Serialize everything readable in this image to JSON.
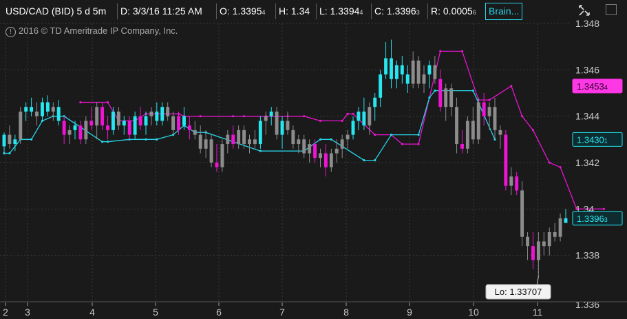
{
  "header": {
    "symbol": "USD/CAD (BID) 5 d 5m",
    "date": "D: 3/3/16 11:25 AM",
    "open_main": "O: 1.3395",
    "open_small": "4",
    "high": "H: 1.34",
    "low_main": "L: 1.3394",
    "low_small": "4",
    "close_main": "C: 1.3396",
    "close_small": "3",
    "range_main": "R: 0.0005",
    "range_small": "6",
    "study": "Brain..."
  },
  "copyright": "2016 © TD Ameritrade IP Company, Inc.",
  "icons": {
    "copyright": "circle-exclamation-icon",
    "corner": "expand-collapse-icon",
    "close": "close-box-icon"
  },
  "colors": {
    "background": "#1a1a1a",
    "up_candle": "#27e6f0",
    "down_candle": "#ee14d4",
    "neutral_candle": "#8c8c8c",
    "grid": "#3a3a3a",
    "upper_band": "#e814d0",
    "lower_band": "#27d4e8"
  },
  "chart_data": {
    "type": "candlestick",
    "title": "USD/CAD (BID) 5 d 5m",
    "ylim": [
      1.336,
      1.348
    ],
    "y_ticks": [
      "1.338",
      "1.34",
      "1.342",
      "1.344",
      "1.346",
      "1.348"
    ],
    "x_ticks": [
      "2",
      "3",
      "4",
      "5",
      "6",
      "7",
      "8",
      "9",
      "10",
      "11"
    ],
    "grid": true,
    "price_tags": [
      {
        "label": "1.34534",
        "main": "1.3453",
        "small": "4",
        "value": 1.3453,
        "style": "magenta"
      },
      {
        "label": "1.34301",
        "main": "1.3430",
        "small": "1",
        "value": 1.343,
        "style": "cyan"
      },
      {
        "label": "1.33963",
        "main": "1.3396",
        "small": "3",
        "value": 1.3396,
        "style": "cyan-last"
      }
    ],
    "low_callout": "Lo: 1.33707",
    "candles": [
      {
        "o": 1.3427,
        "h": 1.3433,
        "l": 1.3424,
        "c": 1.3432,
        "t": "up"
      },
      {
        "o": 1.3432,
        "h": 1.3436,
        "l": 1.3426,
        "c": 1.3428,
        "t": "neutral"
      },
      {
        "o": 1.3428,
        "h": 1.3432,
        "l": 1.3425,
        "c": 1.343,
        "t": "up"
      },
      {
        "o": 1.343,
        "h": 1.3444,
        "l": 1.3428,
        "c": 1.3442,
        "t": "neutral"
      },
      {
        "o": 1.3442,
        "h": 1.3446,
        "l": 1.3438,
        "c": 1.3444,
        "t": "up"
      },
      {
        "o": 1.3444,
        "h": 1.3448,
        "l": 1.344,
        "c": 1.3442,
        "t": "up"
      },
      {
        "o": 1.3442,
        "h": 1.3446,
        "l": 1.3436,
        "c": 1.344,
        "t": "neutral"
      },
      {
        "o": 1.344,
        "h": 1.3448,
        "l": 1.3438,
        "c": 1.3446,
        "t": "up"
      },
      {
        "o": 1.3446,
        "h": 1.3449,
        "l": 1.344,
        "c": 1.3442,
        "t": "up"
      },
      {
        "o": 1.3442,
        "h": 1.3446,
        "l": 1.3438,
        "c": 1.3444,
        "t": "neutral"
      },
      {
        "o": 1.3444,
        "h": 1.3447,
        "l": 1.3436,
        "c": 1.3438,
        "t": "up"
      },
      {
        "o": 1.3438,
        "h": 1.344,
        "l": 1.3428,
        "c": 1.3432,
        "t": "down"
      },
      {
        "o": 1.3432,
        "h": 1.3436,
        "l": 1.3428,
        "c": 1.3434,
        "t": "neutral"
      },
      {
        "o": 1.3434,
        "h": 1.3438,
        "l": 1.343,
        "c": 1.3436,
        "t": "up"
      },
      {
        "o": 1.3436,
        "h": 1.3438,
        "l": 1.3428,
        "c": 1.343,
        "t": "down"
      },
      {
        "o": 1.343,
        "h": 1.344,
        "l": 1.3428,
        "c": 1.3438,
        "t": "neutral"
      },
      {
        "o": 1.3438,
        "h": 1.3444,
        "l": 1.3434,
        "c": 1.3436,
        "t": "down"
      },
      {
        "o": 1.3436,
        "h": 1.3446,
        "l": 1.343,
        "c": 1.3444,
        "t": "neutral"
      },
      {
        "o": 1.3444,
        "h": 1.3446,
        "l": 1.3434,
        "c": 1.3436,
        "t": "down"
      },
      {
        "o": 1.3436,
        "h": 1.344,
        "l": 1.343,
        "c": 1.3434,
        "t": "down"
      },
      {
        "o": 1.3434,
        "h": 1.3444,
        "l": 1.3432,
        "c": 1.3442,
        "t": "up"
      },
      {
        "o": 1.3442,
        "h": 1.3444,
        "l": 1.3434,
        "c": 1.3436,
        "t": "neutral"
      },
      {
        "o": 1.3436,
        "h": 1.344,
        "l": 1.3432,
        "c": 1.3438,
        "t": "up"
      },
      {
        "o": 1.3438,
        "h": 1.344,
        "l": 1.343,
        "c": 1.3432,
        "t": "down"
      },
      {
        "o": 1.3432,
        "h": 1.3442,
        "l": 1.343,
        "c": 1.344,
        "t": "up"
      },
      {
        "o": 1.344,
        "h": 1.3444,
        "l": 1.3434,
        "c": 1.3436,
        "t": "down"
      },
      {
        "o": 1.3436,
        "h": 1.3442,
        "l": 1.3432,
        "c": 1.344,
        "t": "up"
      },
      {
        "o": 1.344,
        "h": 1.3444,
        "l": 1.3436,
        "c": 1.3442,
        "t": "neutral"
      },
      {
        "o": 1.3442,
        "h": 1.3446,
        "l": 1.3436,
        "c": 1.3438,
        "t": "up"
      },
      {
        "o": 1.3438,
        "h": 1.3446,
        "l": 1.3436,
        "c": 1.3444,
        "t": "up"
      },
      {
        "o": 1.3444,
        "h": 1.3446,
        "l": 1.3438,
        "c": 1.344,
        "t": "neutral"
      },
      {
        "o": 1.344,
        "h": 1.3442,
        "l": 1.3432,
        "c": 1.3434,
        "t": "neutral"
      },
      {
        "o": 1.3434,
        "h": 1.3442,
        "l": 1.3432,
        "c": 1.344,
        "t": "down"
      },
      {
        "o": 1.344,
        "h": 1.3444,
        "l": 1.3434,
        "c": 1.3436,
        "t": "up"
      },
      {
        "o": 1.3436,
        "h": 1.344,
        "l": 1.343,
        "c": 1.3434,
        "t": "down"
      },
      {
        "o": 1.3434,
        "h": 1.3438,
        "l": 1.343,
        "c": 1.3432,
        "t": "neutral"
      },
      {
        "o": 1.3432,
        "h": 1.3436,
        "l": 1.3424,
        "c": 1.3426,
        "t": "neutral"
      },
      {
        "o": 1.3426,
        "h": 1.3434,
        "l": 1.3422,
        "c": 1.343,
        "t": "neutral"
      },
      {
        "o": 1.343,
        "h": 1.3432,
        "l": 1.3418,
        "c": 1.342,
        "t": "neutral"
      },
      {
        "o": 1.342,
        "h": 1.3428,
        "l": 1.3416,
        "c": 1.3418,
        "t": "down"
      },
      {
        "o": 1.3418,
        "h": 1.343,
        "l": 1.3416,
        "c": 1.3428,
        "t": "neutral"
      },
      {
        "o": 1.3428,
        "h": 1.3434,
        "l": 1.3424,
        "c": 1.3432,
        "t": "neutral"
      },
      {
        "o": 1.3432,
        "h": 1.3436,
        "l": 1.3426,
        "c": 1.3428,
        "t": "down"
      },
      {
        "o": 1.3428,
        "h": 1.3436,
        "l": 1.3426,
        "c": 1.3434,
        "t": "neutral"
      },
      {
        "o": 1.3434,
        "h": 1.3436,
        "l": 1.3426,
        "c": 1.3428,
        "t": "neutral"
      },
      {
        "o": 1.3428,
        "h": 1.3432,
        "l": 1.3424,
        "c": 1.343,
        "t": "neutral"
      },
      {
        "o": 1.343,
        "h": 1.3434,
        "l": 1.3426,
        "c": 1.3428,
        "t": "neutral"
      },
      {
        "o": 1.3428,
        "h": 1.344,
        "l": 1.3426,
        "c": 1.3438,
        "t": "up"
      },
      {
        "o": 1.3438,
        "h": 1.3442,
        "l": 1.3432,
        "c": 1.344,
        "t": "neutral"
      },
      {
        "o": 1.344,
        "h": 1.3444,
        "l": 1.3436,
        "c": 1.3442,
        "t": "up"
      },
      {
        "o": 1.3442,
        "h": 1.3444,
        "l": 1.343,
        "c": 1.3432,
        "t": "neutral"
      },
      {
        "o": 1.3432,
        "h": 1.344,
        "l": 1.3426,
        "c": 1.3438,
        "t": "up"
      },
      {
        "o": 1.3438,
        "h": 1.3442,
        "l": 1.3432,
        "c": 1.3434,
        "t": "neutral"
      },
      {
        "o": 1.3434,
        "h": 1.3436,
        "l": 1.3426,
        "c": 1.3428,
        "t": "neutral"
      },
      {
        "o": 1.3428,
        "h": 1.3432,
        "l": 1.3424,
        "c": 1.343,
        "t": "neutral"
      },
      {
        "o": 1.343,
        "h": 1.3432,
        "l": 1.3422,
        "c": 1.3424,
        "t": "neutral"
      },
      {
        "o": 1.3424,
        "h": 1.343,
        "l": 1.342,
        "c": 1.3428,
        "t": "neutral"
      },
      {
        "o": 1.3428,
        "h": 1.343,
        "l": 1.342,
        "c": 1.3422,
        "t": "down"
      },
      {
        "o": 1.3422,
        "h": 1.3426,
        "l": 1.3418,
        "c": 1.3424,
        "t": "neutral"
      },
      {
        "o": 1.3424,
        "h": 1.3428,
        "l": 1.3414,
        "c": 1.3418,
        "t": "down"
      },
      {
        "o": 1.3418,
        "h": 1.3426,
        "l": 1.3416,
        "c": 1.3424,
        "t": "neutral"
      },
      {
        "o": 1.3424,
        "h": 1.343,
        "l": 1.342,
        "c": 1.3426,
        "t": "neutral"
      },
      {
        "o": 1.3426,
        "h": 1.3432,
        "l": 1.3422,
        "c": 1.343,
        "t": "neutral"
      },
      {
        "o": 1.343,
        "h": 1.3434,
        "l": 1.3426,
        "c": 1.3432,
        "t": "neutral"
      },
      {
        "o": 1.3432,
        "h": 1.344,
        "l": 1.343,
        "c": 1.3438,
        "t": "up"
      },
      {
        "o": 1.3438,
        "h": 1.3444,
        "l": 1.3434,
        "c": 1.3442,
        "t": "up"
      },
      {
        "o": 1.3442,
        "h": 1.3448,
        "l": 1.3434,
        "c": 1.3436,
        "t": "up"
      },
      {
        "o": 1.3436,
        "h": 1.3446,
        "l": 1.3432,
        "c": 1.3444,
        "t": "neutral"
      },
      {
        "o": 1.3444,
        "h": 1.345,
        "l": 1.3438,
        "c": 1.3448,
        "t": "up"
      },
      {
        "o": 1.3448,
        "h": 1.346,
        "l": 1.3444,
        "c": 1.3458,
        "t": "up"
      },
      {
        "o": 1.3458,
        "h": 1.3472,
        "l": 1.3456,
        "c": 1.3465,
        "t": "up"
      },
      {
        "o": 1.3465,
        "h": 1.3473,
        "l": 1.3452,
        "c": 1.3456,
        "t": "up"
      },
      {
        "o": 1.3456,
        "h": 1.3464,
        "l": 1.3452,
        "c": 1.3462,
        "t": "up"
      },
      {
        "o": 1.3462,
        "h": 1.3466,
        "l": 1.3454,
        "c": 1.3458,
        "t": "up"
      },
      {
        "o": 1.3458,
        "h": 1.3462,
        "l": 1.345,
        "c": 1.3454,
        "t": "up"
      },
      {
        "o": 1.3454,
        "h": 1.3468,
        "l": 1.3452,
        "c": 1.3464,
        "t": "neutral"
      },
      {
        "o": 1.3464,
        "h": 1.3466,
        "l": 1.3452,
        "c": 1.3454,
        "t": "neutral"
      },
      {
        "o": 1.3454,
        "h": 1.3462,
        "l": 1.345,
        "c": 1.3458,
        "t": "neutral"
      },
      {
        "o": 1.3458,
        "h": 1.3464,
        "l": 1.3452,
        "c": 1.3462,
        "t": "up"
      },
      {
        "o": 1.3462,
        "h": 1.3466,
        "l": 1.3454,
        "c": 1.3456,
        "t": "neutral"
      },
      {
        "o": 1.3456,
        "h": 1.346,
        "l": 1.3442,
        "c": 1.3444,
        "t": "down"
      },
      {
        "o": 1.3444,
        "h": 1.3454,
        "l": 1.3438,
        "c": 1.3452,
        "t": "neutral"
      },
      {
        "o": 1.3452,
        "h": 1.3454,
        "l": 1.344,
        "c": 1.3444,
        "t": "neutral"
      },
      {
        "o": 1.3444,
        "h": 1.3448,
        "l": 1.3424,
        "c": 1.3428,
        "t": "neutral"
      },
      {
        "o": 1.3428,
        "h": 1.3434,
        "l": 1.3424,
        "c": 1.3426,
        "t": "down"
      },
      {
        "o": 1.3426,
        "h": 1.344,
        "l": 1.3424,
        "c": 1.3438,
        "t": "neutral"
      },
      {
        "o": 1.3438,
        "h": 1.3444,
        "l": 1.3428,
        "c": 1.343,
        "t": "neutral"
      },
      {
        "o": 1.343,
        "h": 1.3448,
        "l": 1.3428,
        "c": 1.3446,
        "t": "neutral"
      },
      {
        "o": 1.3446,
        "h": 1.345,
        "l": 1.3436,
        "c": 1.344,
        "t": "down"
      },
      {
        "o": 1.344,
        "h": 1.3446,
        "l": 1.3434,
        "c": 1.3444,
        "t": "neutral"
      },
      {
        "o": 1.3444,
        "h": 1.3448,
        "l": 1.343,
        "c": 1.3434,
        "t": "neutral"
      },
      {
        "o": 1.3434,
        "h": 1.3436,
        "l": 1.3426,
        "c": 1.3432,
        "t": "neutral"
      },
      {
        "o": 1.3432,
        "h": 1.3434,
        "l": 1.3408,
        "c": 1.341,
        "t": "down"
      },
      {
        "o": 1.341,
        "h": 1.3418,
        "l": 1.3406,
        "c": 1.3414,
        "t": "neutral"
      },
      {
        "o": 1.3414,
        "h": 1.3416,
        "l": 1.3406,
        "c": 1.3408,
        "t": "down"
      },
      {
        "o": 1.3408,
        "h": 1.3412,
        "l": 1.3384,
        "c": 1.3388,
        "t": "neutral"
      },
      {
        "o": 1.3388,
        "h": 1.339,
        "l": 1.3378,
        "c": 1.3384,
        "t": "neutral"
      },
      {
        "o": 1.3384,
        "h": 1.339,
        "l": 1.3374,
        "c": 1.3378,
        "t": "down"
      },
      {
        "o": 1.3378,
        "h": 1.339,
        "l": 1.3371,
        "c": 1.3386,
        "t": "neutral"
      },
      {
        "o": 1.3386,
        "h": 1.339,
        "l": 1.338,
        "c": 1.3384,
        "t": "neutral"
      },
      {
        "o": 1.3384,
        "h": 1.3392,
        "l": 1.338,
        "c": 1.339,
        "t": "neutral"
      },
      {
        "o": 1.339,
        "h": 1.3394,
        "l": 1.3386,
        "c": 1.3388,
        "t": "neutral"
      },
      {
        "o": 1.3388,
        "h": 1.3398,
        "l": 1.3386,
        "c": 1.3396,
        "t": "neutral"
      },
      {
        "o": 1.3394,
        "h": 1.34,
        "l": 1.3394,
        "c": 1.3396,
        "t": "up"
      }
    ],
    "upper_band": [
      {
        "i": 14,
        "v": 1.3446
      },
      {
        "i": 19,
        "v": 1.3446
      },
      {
        "i": 21,
        "v": 1.3438
      },
      {
        "i": 24,
        "v": 1.3438
      },
      {
        "i": 26,
        "v": 1.3441
      },
      {
        "i": 32,
        "v": 1.3441
      },
      {
        "i": 33,
        "v": 1.344
      },
      {
        "i": 36,
        "v": 1.344
      },
      {
        "i": 42,
        "v": 1.344
      },
      {
        "i": 44,
        "v": 1.344
      },
      {
        "i": 48,
        "v": 1.344
      },
      {
        "i": 52,
        "v": 1.344
      },
      {
        "i": 55,
        "v": 1.344
      },
      {
        "i": 58,
        "v": 1.3438
      },
      {
        "i": 62,
        "v": 1.3438
      },
      {
        "i": 63,
        "v": 1.3441
      },
      {
        "i": 64,
        "v": 1.3441
      },
      {
        "i": 68,
        "v": 1.3432
      },
      {
        "i": 71,
        "v": 1.3432
      },
      {
        "i": 73,
        "v": 1.3428
      },
      {
        "i": 76,
        "v": 1.3428
      },
      {
        "i": 80,
        "v": 1.3468
      },
      {
        "i": 84,
        "v": 1.3468
      },
      {
        "i": 87,
        "v": 1.3447
      },
      {
        "i": 89,
        "v": 1.3447
      },
      {
        "i": 93,
        "v": 1.3453
      },
      {
        "i": 95,
        "v": 1.344
      },
      {
        "i": 97,
        "v": 1.3434
      },
      {
        "i": 100,
        "v": 1.342
      },
      {
        "i": 102,
        "v": 1.3418
      },
      {
        "i": 105,
        "v": 1.34
      },
      {
        "i": 110,
        "v": 1.34
      }
    ],
    "lower_band": [
      {
        "i": 0,
        "v": 1.3424
      },
      {
        "i": 1,
        "v": 1.3424
      },
      {
        "i": 3,
        "v": 1.343
      },
      {
        "i": 5,
        "v": 1.343
      },
      {
        "i": 7,
        "v": 1.3438
      },
      {
        "i": 9,
        "v": 1.344
      },
      {
        "i": 11,
        "v": 1.344
      },
      {
        "i": 18,
        "v": 1.3429
      },
      {
        "i": 19,
        "v": 1.3429
      },
      {
        "i": 23,
        "v": 1.343
      },
      {
        "i": 26,
        "v": 1.343
      },
      {
        "i": 28,
        "v": 1.343
      },
      {
        "i": 31,
        "v": 1.3432
      },
      {
        "i": 33,
        "v": 1.3436
      },
      {
        "i": 35,
        "v": 1.3433
      },
      {
        "i": 37,
        "v": 1.3433
      },
      {
        "i": 47,
        "v": 1.3425
      },
      {
        "i": 55,
        "v": 1.3425
      },
      {
        "i": 58,
        "v": 1.343
      },
      {
        "i": 60,
        "v": 1.343
      },
      {
        "i": 66,
        "v": 1.3421
      },
      {
        "i": 68,
        "v": 1.3421
      },
      {
        "i": 71,
        "v": 1.3432
      },
      {
        "i": 76,
        "v": 1.3432
      },
      {
        "i": 78,
        "v": 1.3448
      },
      {
        "i": 79,
        "v": 1.3451
      },
      {
        "i": 86,
        "v": 1.3451
      },
      {
        "i": 90,
        "v": 1.343
      }
    ]
  }
}
